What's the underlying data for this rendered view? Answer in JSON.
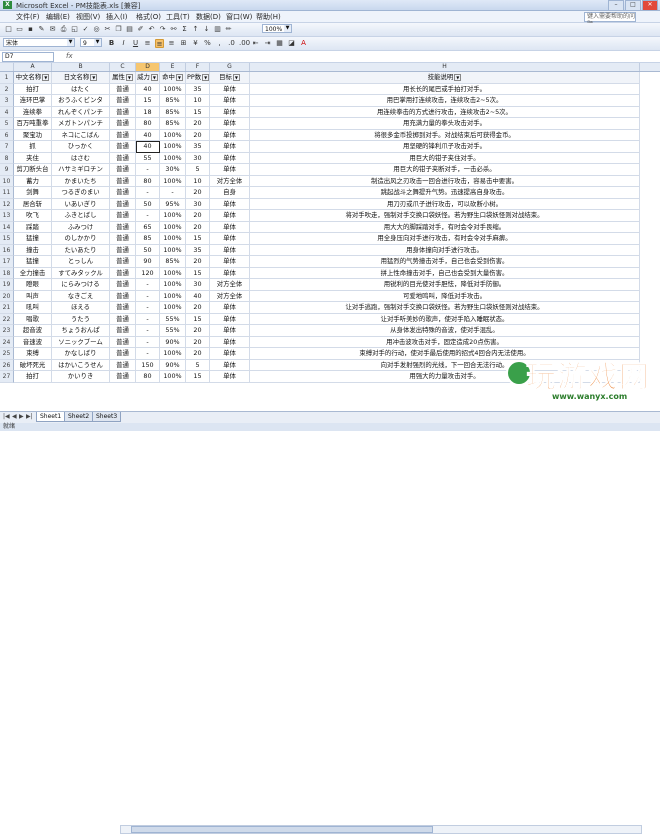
{
  "window": {
    "title": "Microsoft Excel - PM技能表.xls [兼容]"
  },
  "menu": [
    "文件(F)",
    "编辑(E)",
    "视图(V)",
    "插入(I)",
    "格式(O)",
    "工具(T)",
    "数据(D)",
    "窗口(W)",
    "帮助(H)"
  ],
  "help_placeholder": "键入需要帮助的问题",
  "toolbar": {
    "zoom": "100%",
    "font_name": "宋体",
    "font_size": "9"
  },
  "formula_bar": {
    "name_box": "D7",
    "fx": "fx",
    "value": ""
  },
  "columns": [
    "A",
    "B",
    "C",
    "D",
    "E",
    "F",
    "G",
    "H",
    "I"
  ],
  "selected_column": "D",
  "headers": [
    "中文名称",
    "日文名称",
    "属性",
    "威力",
    "命中",
    "PP数",
    "目标",
    "技能说明"
  ],
  "rows": [
    [
      "拍打",
      "はたく",
      "普通",
      "40",
      "100%",
      "35",
      "单体",
      "用长长的尾巴或手拍打对手。"
    ],
    [
      "连环巴掌",
      "おうふくビンタ",
      "普通",
      "15",
      "85%",
      "10",
      "单体",
      "用巴掌用打连续攻击，连续攻击2~5次。"
    ],
    [
      "连续拳",
      "れんぞくパンチ",
      "普通",
      "18",
      "85%",
      "15",
      "单体",
      "用连续拳击的方式进行攻击，连续攻击2~5次。"
    ],
    [
      "百万吨重拳",
      "メガトンパンチ",
      "普通",
      "80",
      "85%",
      "20",
      "单体",
      "用充满力量的拳头攻击对手。"
    ],
    [
      "聚宝功",
      "ネコにこばん",
      "普通",
      "40",
      "100%",
      "20",
      "单体",
      "将很多金币投掷到对手。对战结束后可获得金币。"
    ],
    [
      "抓",
      "ひっかく",
      "普通",
      "40",
      "100%",
      "35",
      "单体",
      "用坚硬的锋利爪子攻击对手。"
    ],
    [
      "夹住",
      "はさむ",
      "普通",
      "55",
      "100%",
      "30",
      "单体",
      "用巨大的钳子夹住对手。"
    ],
    [
      "剪刀断头台",
      "ハサミギロチン",
      "普通",
      "-",
      "30%",
      "5",
      "单体",
      "用巨大的钳子夹断对手，一击必杀。"
    ],
    [
      "蓄力",
      "かまいたち",
      "普通",
      "80",
      "100%",
      "10",
      "对方全体",
      "制造出风之刃攻击一回合进行攻击，容易击中要害。"
    ],
    [
      "剑舞",
      "つるぎのまい",
      "普通",
      "-",
      "-",
      "20",
      "自身",
      "跳起战斗之舞提升气势。迅速提高自身攻击。"
    ],
    [
      "居合斩",
      "いあいぎり",
      "普通",
      "50",
      "95%",
      "30",
      "单体",
      "用刀刃或爪子进行攻击，可以砍断小树。"
    ],
    [
      "吹飞",
      "ふきとばし",
      "普通",
      "-",
      "100%",
      "20",
      "单体",
      "将对手吹走，强制对手交换口袋妖怪。若为野生口袋妖怪则对战结束。"
    ],
    [
      "踩踏",
      "ふみつけ",
      "普通",
      "65",
      "100%",
      "20",
      "单体",
      "用大大的脚踩踏对手，有时会令对手畏缩。"
    ],
    [
      "猛撞",
      "のしかかり",
      "普通",
      "85",
      "100%",
      "15",
      "单体",
      "用全身压向对手进行攻击，有时会令对手麻痹。"
    ],
    [
      "撞击",
      "たいあたり",
      "普通",
      "50",
      "100%",
      "35",
      "单体",
      "用身体撞向对手进行攻击。"
    ],
    [
      "猛撞",
      "とっしん",
      "普通",
      "90",
      "85%",
      "20",
      "单体",
      "用猛烈的气势撞击对手，自己也会受到伤害。"
    ],
    [
      "全力撞击",
      "すてみタックル",
      "普通",
      "120",
      "100%",
      "15",
      "单体",
      "拼上性命撞击对手，自己也会受到大量伤害。"
    ],
    [
      "瞪眼",
      "にらみつける",
      "普通",
      "-",
      "100%",
      "30",
      "对方全体",
      "用锐利的目光使对手胆怯，降低对手防御。"
    ],
    [
      "叫声",
      "なきごえ",
      "普通",
      "-",
      "100%",
      "40",
      "对方全体",
      "可爱地鸣叫，降低对手攻击。"
    ],
    [
      "吼叫",
      "ほえる",
      "普通",
      "-",
      "100%",
      "20",
      "单体",
      "让对手逃跑，强制对手交换口袋妖怪。若为野生口袋妖怪则对战结束。"
    ],
    [
      "唱歌",
      "うたう",
      "普通",
      "-",
      "55%",
      "15",
      "单体",
      "让对手听美妙的歌声，使对手陷入睡眠状态。"
    ],
    [
      "超音波",
      "ちょうおんぱ",
      "普通",
      "-",
      "55%",
      "20",
      "单体",
      "从身体发出特殊的音波，使对手混乱。"
    ],
    [
      "音速波",
      "ソニックブーム",
      "普通",
      "-",
      "90%",
      "20",
      "单体",
      "用冲击波攻击对手，固定造成20点伤害。"
    ],
    [
      "束缚",
      "かなしばり",
      "普通",
      "-",
      "100%",
      "20",
      "单体",
      "束缚对手的行动，使对手最后使用的招式4回合内无法使用。"
    ],
    [
      "破坏死光",
      "はかいこうせん",
      "普通",
      "150",
      "90%",
      "5",
      "单体",
      "向对手发射强烈的光线，下一回合无法行动。"
    ],
    [
      "拍打",
      "かいりき",
      "普通",
      "80",
      "100%",
      "15",
      "单体",
      "用强大的力量攻击对手。"
    ]
  ],
  "sheets": [
    "Sheet1",
    "Sheet2",
    "Sheet3"
  ],
  "active_sheet": "Sheet1",
  "status": "就绪",
  "watermark": {
    "brand": "玩游戏网",
    "url": "www.wanyx.com"
  },
  "colors": {
    "selection": "#f6c66f",
    "grid": "#d3dbe8",
    "header_bg": "#e4ebf5",
    "watermark": "#e8731c"
  }
}
